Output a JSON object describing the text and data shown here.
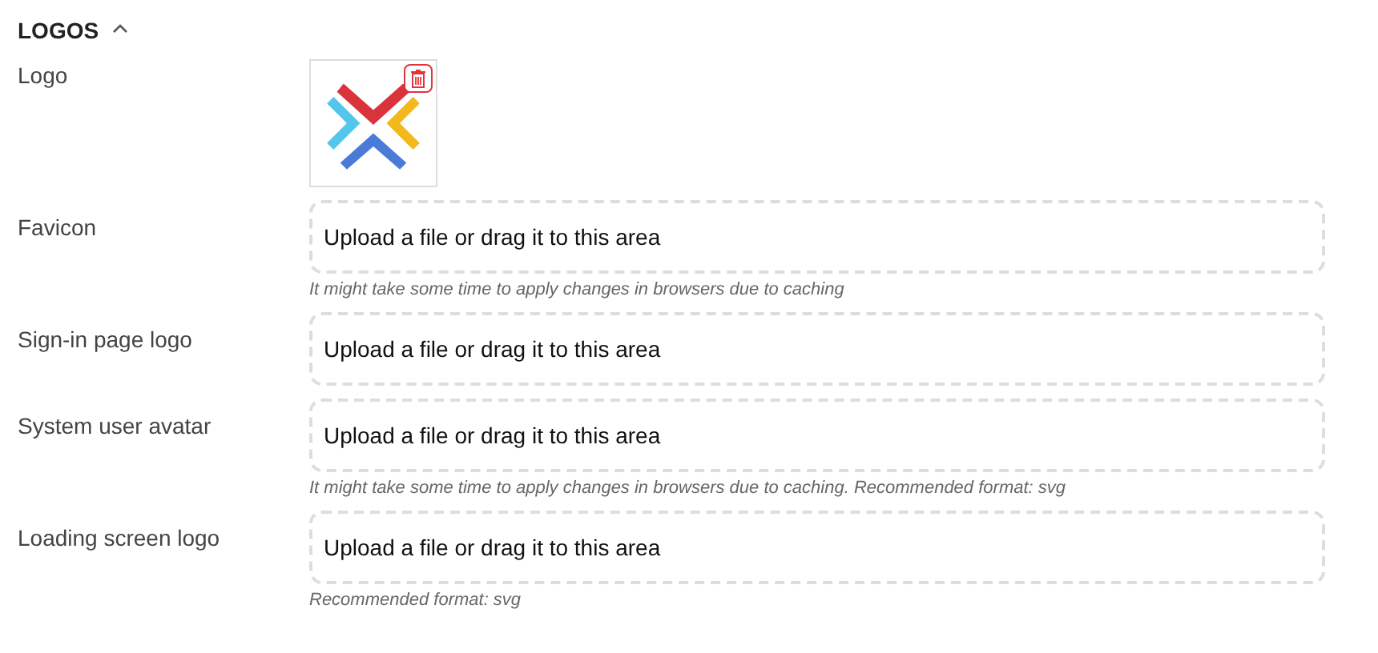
{
  "section": {
    "title": "LOGOS",
    "expanded": true
  },
  "rows": [
    {
      "kind": "image",
      "label": "Logo"
    },
    {
      "kind": "upload",
      "label": "Favicon",
      "text": "Upload a file or drag it to this area",
      "hint": "It might take some time to apply changes in browsers due to caching"
    },
    {
      "kind": "upload",
      "label": "Sign-in page logo",
      "text": "Upload a file or drag it to this area"
    },
    {
      "kind": "upload",
      "label": "System user avatar",
      "text": "Upload a file or drag it to this area",
      "hint": "It might take some time to apply changes in browsers due to caching. Recommended format: svg"
    },
    {
      "kind": "upload",
      "label": "Loading screen logo",
      "text": "Upload a file or drag it to this area",
      "hint": "Recommended format: svg"
    }
  ]
}
